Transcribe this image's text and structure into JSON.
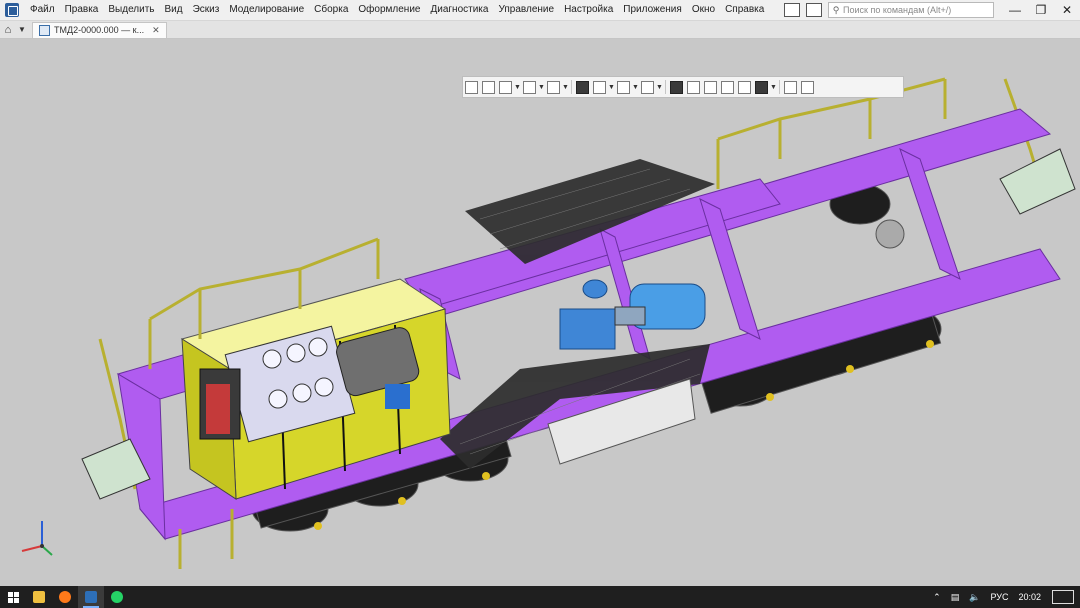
{
  "menu": {
    "items": [
      "Файл",
      "Правка",
      "Выделить",
      "Вид",
      "Эскиз",
      "Моделирование",
      "Сборка",
      "Оформление",
      "Диагностика",
      "Управление",
      "Настройка",
      "Приложения",
      "Окно",
      "Справка"
    ],
    "search_placeholder": "Поиск по командам (Alt+/)"
  },
  "tabs": {
    "document_title": "ТМД2-0000.000 — к..."
  },
  "taskbar": {
    "language": "РУС",
    "time": "20:02",
    "apps": [
      "file-explorer-icon",
      "firefox-icon",
      "kompas-3d-icon",
      "whatsapp-icon"
    ]
  },
  "colors": {
    "frame": "#b05cf0",
    "cabin": "#d6d62a",
    "mesh": "#2c2c2c",
    "engine": "#d9d9ee",
    "motor": "#4a8fd6",
    "wheels": "#1e1e1e",
    "rails": "#b8b030",
    "background": "#c8c8c8"
  }
}
